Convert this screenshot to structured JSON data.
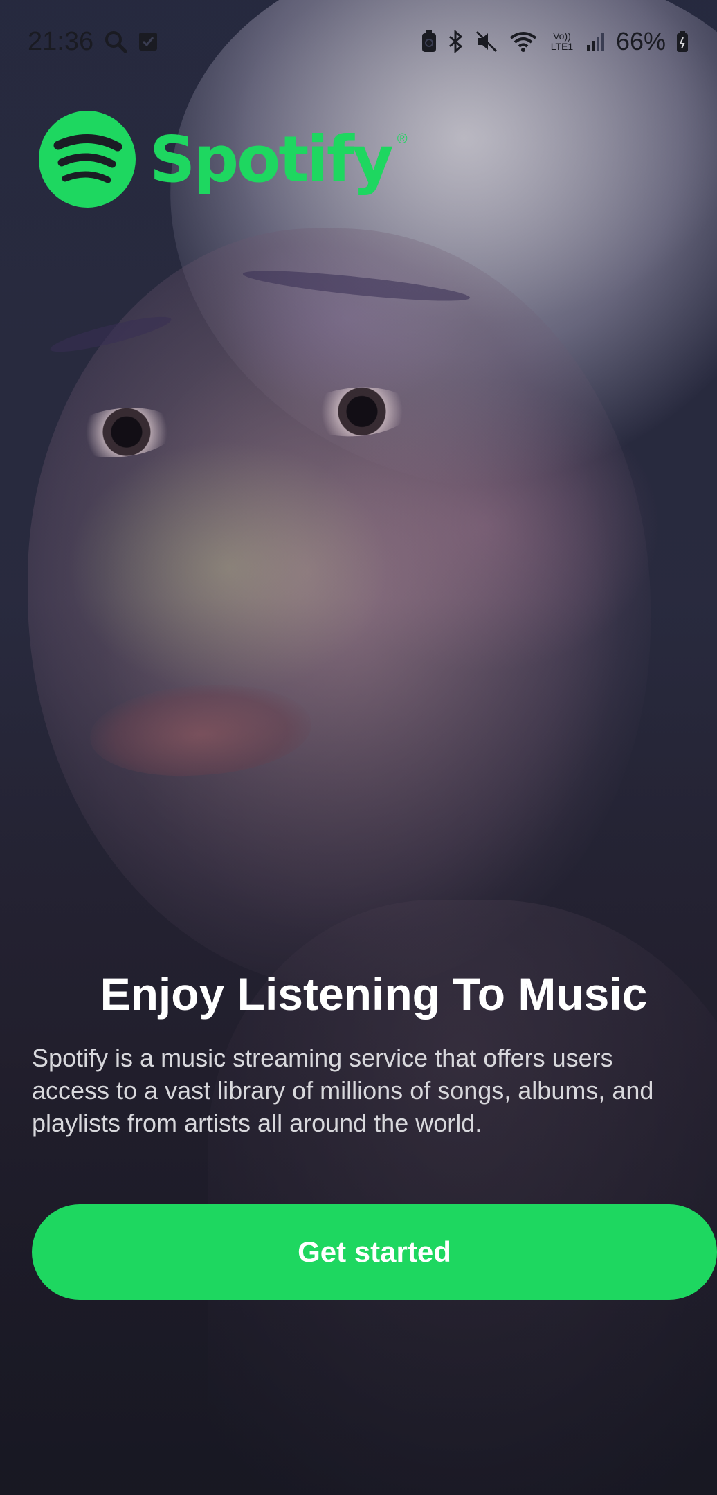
{
  "status_bar": {
    "time": "21:36",
    "battery_percent": "66%",
    "icons_left": [
      "search-icon",
      "checkbox-notification-icon"
    ],
    "icons_right": [
      "battery-saver-icon",
      "bluetooth-icon",
      "mute-icon",
      "wifi-icon",
      "volte-icon",
      "signal-icon",
      "battery-icon"
    ],
    "volte_label": "Vo)) LTE1"
  },
  "brand": {
    "name": "Spotify",
    "registered_mark": "®",
    "color": "#1ed760"
  },
  "onboarding": {
    "headline": "Enjoy Listening To Music",
    "description": "Spotify is a music streaming service that offers users access to a vast library of millions of songs, albums, and playlists from artists all around the world.",
    "cta_label": "Get started"
  }
}
